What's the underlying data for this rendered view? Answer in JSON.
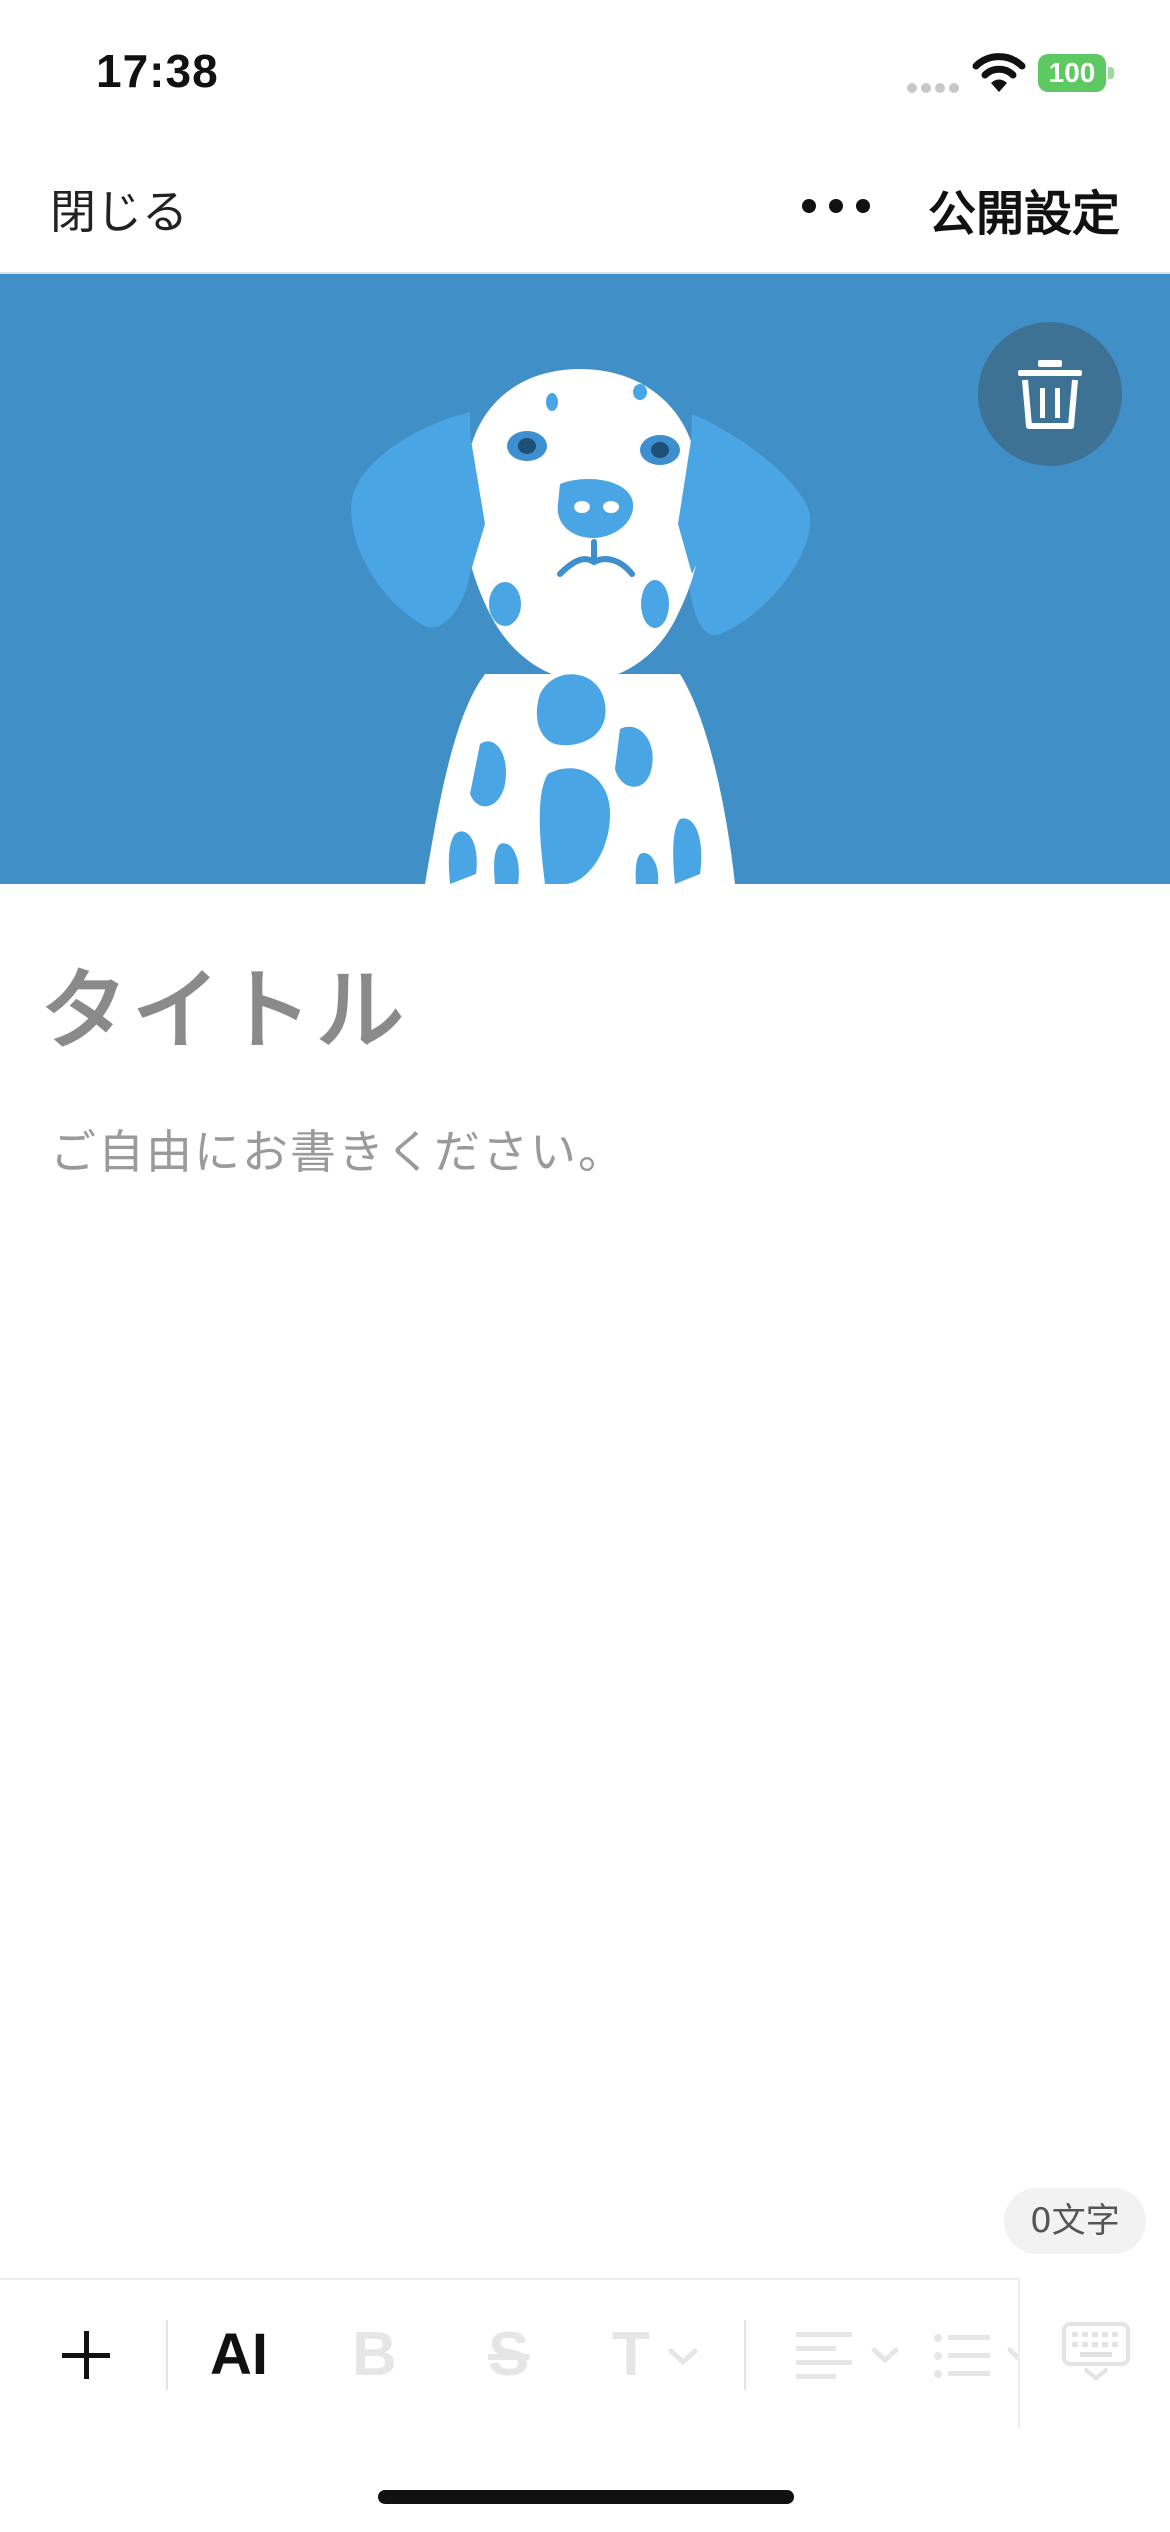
{
  "status_bar": {
    "time": "17:38",
    "battery_level": "100",
    "icons": [
      "signal-icon",
      "wifi-icon",
      "battery-icon"
    ],
    "battery_color": "#5ec862"
  },
  "nav": {
    "close_label": "閉じる",
    "more_icon": "more-dots-icon",
    "publish_label": "公開設定"
  },
  "header_image": {
    "subject": "dalmatian-illustration",
    "background_color": "#418fc7",
    "delete_icon": "trash-icon"
  },
  "editor": {
    "title_placeholder": "タイトル",
    "body_placeholder": "ご自由にお書きください。",
    "char_count": "0文字"
  },
  "toolbar": {
    "add_icon": "plus-icon",
    "ai_label": "AI",
    "bold_label": "B",
    "strike_label": "S",
    "text_label": "T",
    "align_icon": "align-left-icon",
    "list_icon": "bullet-list-icon",
    "keyboard_icon": "keyboard-hide-icon"
  }
}
